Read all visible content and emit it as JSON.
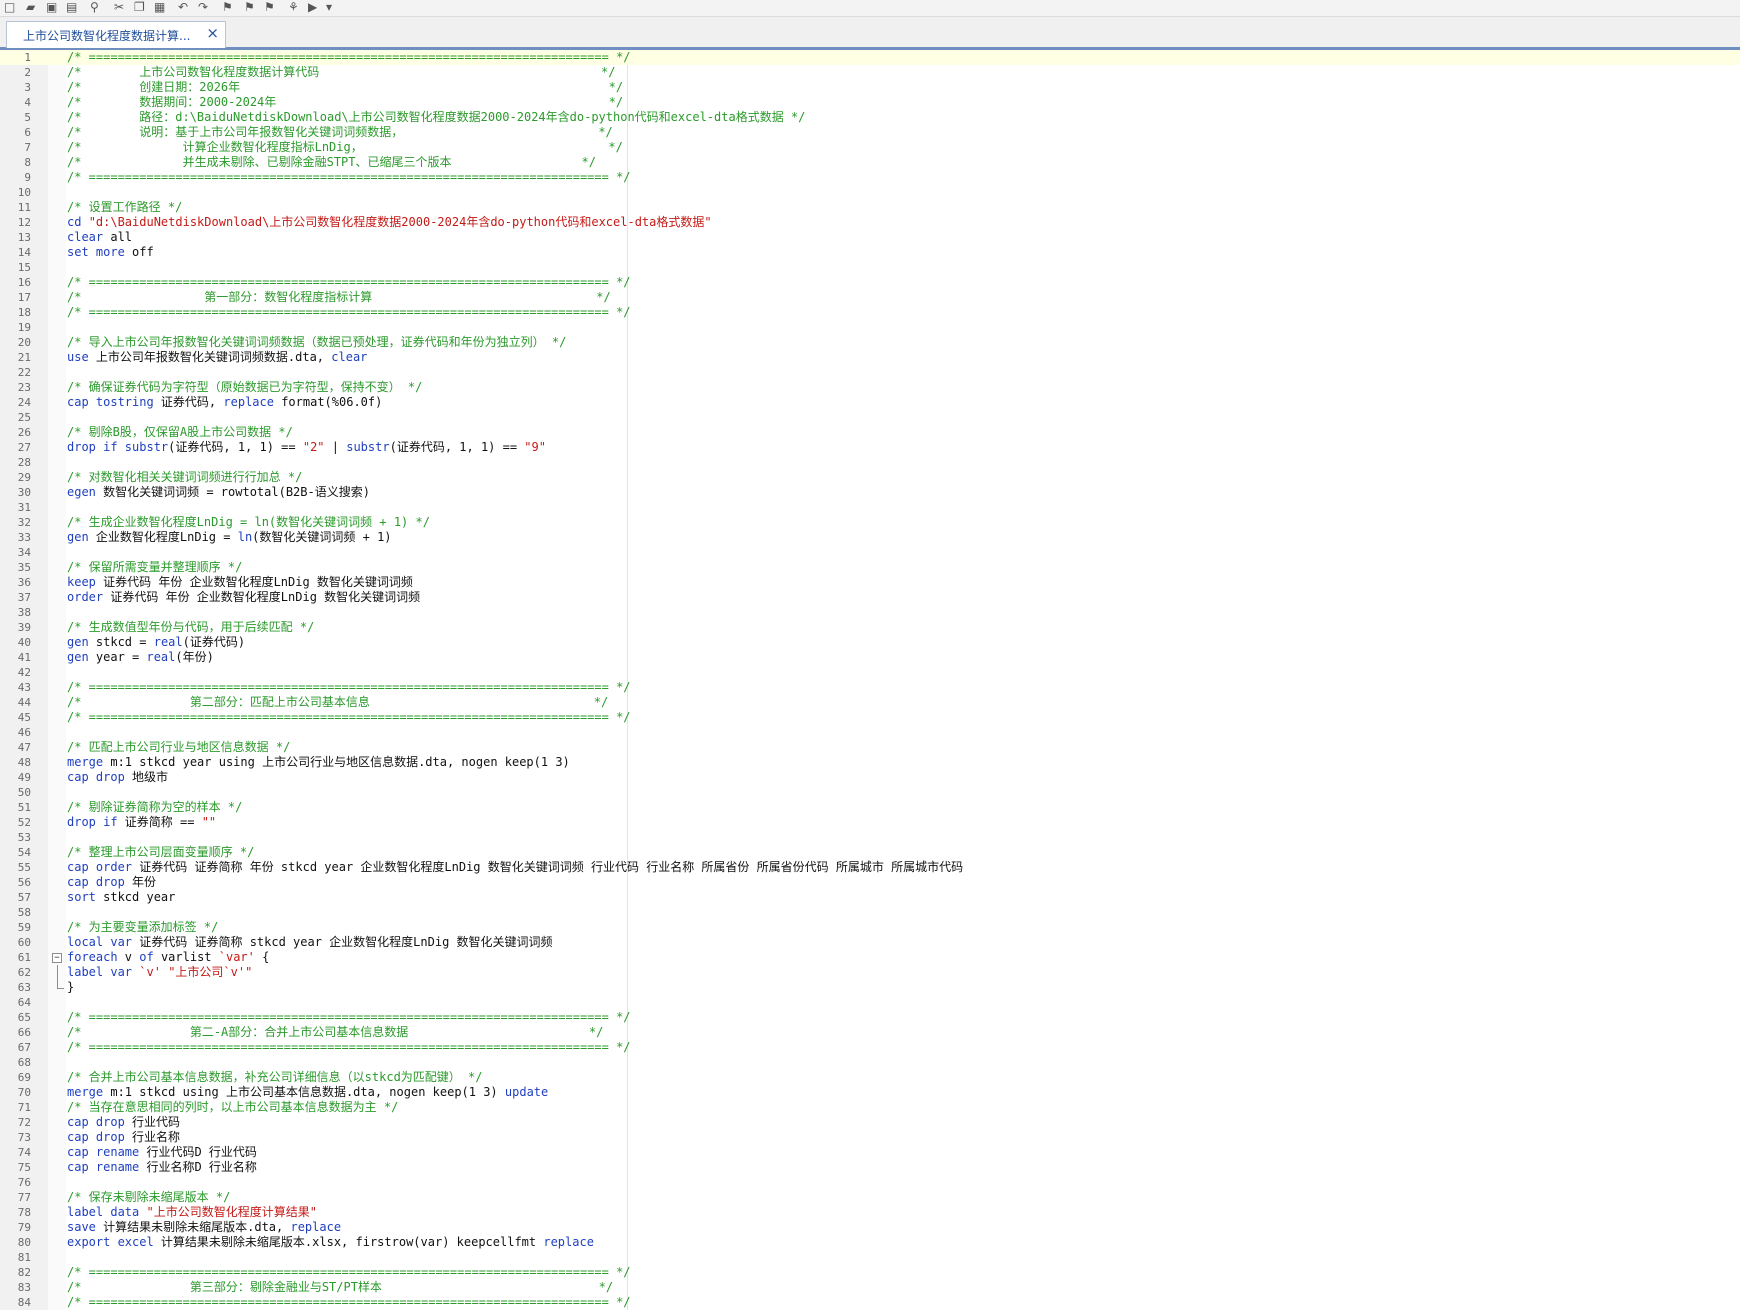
{
  "toolbar": {
    "icons": [
      "new-file-icon",
      "open-folder-icon",
      "save-icon",
      "print-icon",
      "find-icon",
      "cut-icon",
      "copy-icon",
      "paste-icon",
      "undo-icon",
      "redo-icon",
      "bookmark-toggle-icon",
      "bookmark-prev-icon",
      "bookmark-next-icon",
      "run-icon",
      "do-icon",
      "dropdown-icon"
    ]
  },
  "tab": {
    "label": "上市公司数智化程度数据计算...",
    "close": "×"
  },
  "colors": {
    "comment": "#2b9a2b",
    "keyword": "#1f3fbf",
    "string": "#c41a16",
    "tab_accent": "#6e8fbf",
    "current_line": "#ffffe3"
  },
  "lines": [
    [
      [
        "cm",
        "/* ======================================================================== */"
      ]
    ],
    [
      [
        "cm",
        "/*        上市公司数智化程度数据计算代码                                       */"
      ]
    ],
    [
      [
        "cm",
        "/*        创建日期：2026年                                                   */"
      ]
    ],
    [
      [
        "cm",
        "/*        数据期间：2000-2024年                                              */"
      ]
    ],
    [
      [
        "cm",
        "/*        路径：d:\\BaiduNetdiskDownload\\上市公司数智化程度数据2000-2024年含do-python代码和excel-dta格式数据 */"
      ]
    ],
    [
      [
        "cm",
        "/*        说明：基于上市公司年报数智化关键词词频数据，                           */"
      ]
    ],
    [
      [
        "cm",
        "/*              计算企业数智化程度指标LnDig，                                  */"
      ]
    ],
    [
      [
        "cm",
        "/*              并生成未剔除、已剔除金融STPT、已缩尾三个版本                  */"
      ]
    ],
    [
      [
        "cm",
        "/* ======================================================================== */"
      ]
    ],
    [],
    [
      [
        "cm",
        "/* 设置工作路径 */"
      ]
    ],
    [
      [
        "kw",
        "cd "
      ],
      [
        "st",
        "\"d:\\BaiduNetdiskDownload\\上市公司数智化程度数据2000-2024年含do-python代码和excel-dta格式数据\""
      ]
    ],
    [
      [
        "kw",
        "clear"
      ],
      [
        "df",
        " all"
      ]
    ],
    [
      [
        "kw",
        "set more"
      ],
      [
        "df",
        " off"
      ]
    ],
    [],
    [
      [
        "cm",
        "/* ======================================================================== */"
      ]
    ],
    [
      [
        "cm",
        "/*                 第一部分：数智化程度指标计算                               */"
      ]
    ],
    [
      [
        "cm",
        "/* ======================================================================== */"
      ]
    ],
    [],
    [
      [
        "cm",
        "/* 导入上市公司年报数智化关键词词频数据（数据已预处理，证券代码和年份为独立列） */"
      ]
    ],
    [
      [
        "kw",
        "use"
      ],
      [
        "df",
        " 上市公司年报数智化关键词词频数据.dta, "
      ],
      [
        "kw",
        "clear"
      ]
    ],
    [],
    [
      [
        "cm",
        "/* 确保证券代码为字符型（原始数据已为字符型，保持不变） */"
      ]
    ],
    [
      [
        "kw",
        "cap tostring"
      ],
      [
        "df",
        " 证券代码, "
      ],
      [
        "kw",
        "replace"
      ],
      [
        "df",
        " format(%06.0f)"
      ]
    ],
    [],
    [
      [
        "cm",
        "/* 剔除B股，仅保留A股上市公司数据 */"
      ]
    ],
    [
      [
        "kw",
        "drop if "
      ],
      [
        "fn",
        "substr"
      ],
      [
        "df",
        "(证券代码, 1, 1) == "
      ],
      [
        "st",
        "\"2\""
      ],
      [
        "df",
        " | "
      ],
      [
        "fn",
        "substr"
      ],
      [
        "df",
        "(证券代码, 1, 1) == "
      ],
      [
        "st",
        "\"9\""
      ]
    ],
    [],
    [
      [
        "cm",
        "/* 对数智化相关关键词词频进行行加总 */"
      ]
    ],
    [
      [
        "kw",
        "egen"
      ],
      [
        "df",
        " 数智化关键词词频 = rowtotal(B2B-语义搜索)"
      ]
    ],
    [],
    [
      [
        "cm",
        "/* 生成企业数智化程度LnDig = ln(数智化关键词词频 + 1) */"
      ]
    ],
    [
      [
        "kw",
        "gen"
      ],
      [
        "df",
        " 企业数智化程度LnDig = "
      ],
      [
        "fn",
        "ln"
      ],
      [
        "df",
        "(数智化关键词词频 + 1)"
      ]
    ],
    [],
    [
      [
        "cm",
        "/* 保留所需变量并整理顺序 */"
      ]
    ],
    [
      [
        "kw",
        "keep"
      ],
      [
        "df",
        " 证券代码 年份 企业数智化程度LnDig 数智化关键词词频"
      ]
    ],
    [
      [
        "kw",
        "order"
      ],
      [
        "df",
        " 证券代码 年份 企业数智化程度LnDig 数智化关键词词频"
      ]
    ],
    [],
    [
      [
        "cm",
        "/* 生成数值型年份与代码，用于后续匹配 */"
      ]
    ],
    [
      [
        "kw",
        "gen"
      ],
      [
        "df",
        " stkcd = "
      ],
      [
        "fn",
        "real"
      ],
      [
        "df",
        "(证券代码)"
      ]
    ],
    [
      [
        "kw",
        "gen"
      ],
      [
        "df",
        " year = "
      ],
      [
        "fn",
        "real"
      ],
      [
        "df",
        "(年份)"
      ]
    ],
    [],
    [
      [
        "cm",
        "/* ======================================================================== */"
      ]
    ],
    [
      [
        "cm",
        "/*               第二部分：匹配上市公司基本信息                               */"
      ]
    ],
    [
      [
        "cm",
        "/* ======================================================================== */"
      ]
    ],
    [],
    [
      [
        "cm",
        "/* 匹配上市公司行业与地区信息数据 */"
      ]
    ],
    [
      [
        "kw",
        "merge"
      ],
      [
        "df",
        " m:1 stkcd year using 上市公司行业与地区信息数据.dta, nogen keep(1 3)"
      ]
    ],
    [
      [
        "kw",
        "cap drop"
      ],
      [
        "df",
        " 地级市"
      ]
    ],
    [],
    [
      [
        "cm",
        "/* 剔除证券简称为空的样本 */"
      ]
    ],
    [
      [
        "kw",
        "drop if"
      ],
      [
        "df",
        " 证券简称 == "
      ],
      [
        "st",
        "\"\""
      ]
    ],
    [],
    [
      [
        "cm",
        "/* 整理上市公司层面变量顺序 */"
      ]
    ],
    [
      [
        "kw",
        "cap order"
      ],
      [
        "df",
        " 证券代码 证券简称 年份 stkcd year 企业数智化程度LnDig 数智化关键词词频 行业代码 行业名称 所属省份 所属省份代码 所属城市 所属城市代码"
      ]
    ],
    [
      [
        "kw",
        "cap drop"
      ],
      [
        "df",
        " 年份"
      ]
    ],
    [
      [
        "kw",
        "sort"
      ],
      [
        "df",
        " stkcd year"
      ]
    ],
    [],
    [
      [
        "cm",
        "/* 为主要变量添加标签 */"
      ]
    ],
    [
      [
        "kw",
        "local var"
      ],
      [
        "df",
        " 证券代码 证券简称 stkcd year 企业数智化程度LnDig 数智化关键词词频"
      ]
    ],
    [
      [
        "kw",
        "foreach"
      ],
      [
        "df",
        " v "
      ],
      [
        "kw",
        "of"
      ],
      [
        "df",
        " varlist "
      ],
      [
        "st",
        "`var'"
      ],
      [
        "df",
        " {"
      ]
    ],
    [
      [
        "kw",
        "label var"
      ],
      [
        "df",
        " "
      ],
      [
        "st",
        "`v'"
      ],
      [
        "df",
        " "
      ],
      [
        "st",
        "\"上市公司`v'\""
      ]
    ],
    [
      [
        "df",
        "}"
      ]
    ],
    [],
    [
      [
        "cm",
        "/* ======================================================================== */"
      ]
    ],
    [
      [
        "cm",
        "/*               第二-A部分：合并上市公司基本信息数据                         */"
      ]
    ],
    [
      [
        "cm",
        "/* ======================================================================== */"
      ]
    ],
    [],
    [
      [
        "cm",
        "/* 合并上市公司基本信息数据，补充公司详细信息（以stkcd为匹配键） */"
      ]
    ],
    [
      [
        "kw",
        "merge"
      ],
      [
        "df",
        " m:1 stkcd using 上市公司基本信息数据.dta, nogen keep(1 3) "
      ],
      [
        "kw",
        "update"
      ]
    ],
    [
      [
        "cm",
        "/* 当存在意思相同的列时，以上市公司基本信息数据为主 */"
      ]
    ],
    [
      [
        "kw",
        "cap drop"
      ],
      [
        "df",
        " 行业代码"
      ]
    ],
    [
      [
        "kw",
        "cap drop"
      ],
      [
        "df",
        " 行业名称"
      ]
    ],
    [
      [
        "kw",
        "cap rename"
      ],
      [
        "df",
        " 行业代码D 行业代码"
      ]
    ],
    [
      [
        "kw",
        "cap rename"
      ],
      [
        "df",
        " 行业名称D 行业名称"
      ]
    ],
    [],
    [
      [
        "cm",
        "/* 保存未剔除未缩尾版本 */"
      ]
    ],
    [
      [
        "kw",
        "label data"
      ],
      [
        "df",
        " "
      ],
      [
        "st",
        "\"上市公司数智化程度计算结果\""
      ]
    ],
    [
      [
        "kw",
        "save"
      ],
      [
        "df",
        " 计算结果未剔除未缩尾版本.dta, "
      ],
      [
        "kw",
        "replace"
      ]
    ],
    [
      [
        "kw",
        "export excel"
      ],
      [
        "df",
        " 计算结果未剔除未缩尾版本.xlsx, firstrow(var) keepcellfmt "
      ],
      [
        "kw",
        "replace"
      ]
    ],
    [],
    [
      [
        "cm",
        "/* ======================================================================== */"
      ]
    ],
    [
      [
        "cm",
        "/*               第三部分：剔除金融业与ST/PT样本                              */"
      ]
    ],
    [
      [
        "cm",
        "/* ======================================================================== */"
      ]
    ]
  ]
}
